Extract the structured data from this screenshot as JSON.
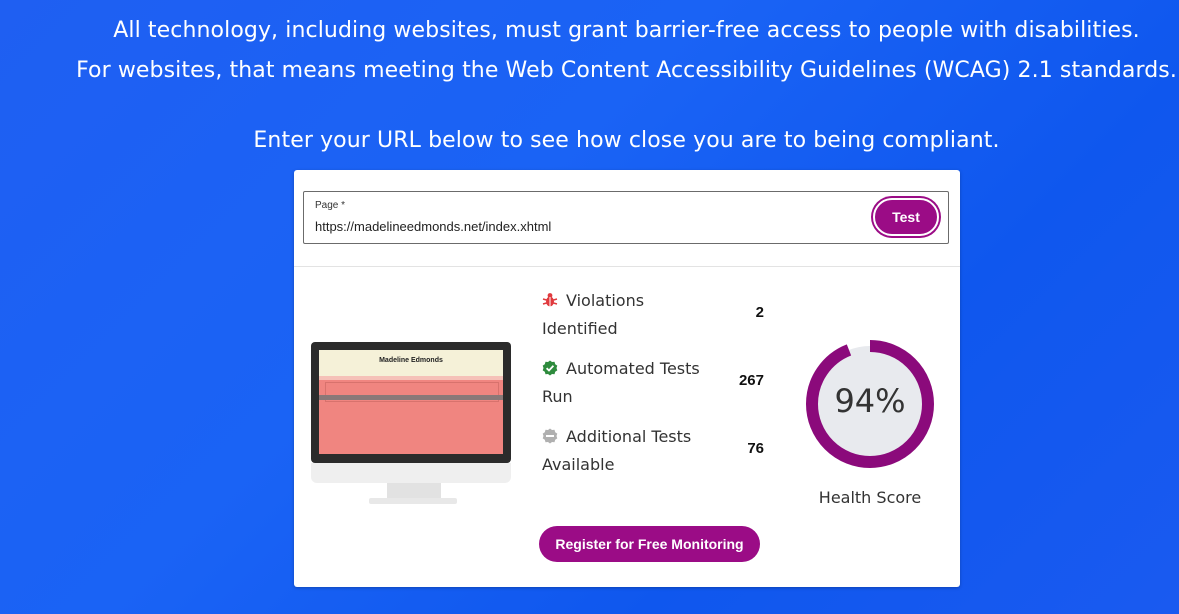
{
  "hero": {
    "line1": "All technology, including websites, must grant barrier-free access to people with disabilities.",
    "line2": "For websites, that means meeting the Web Content Accessibility Guidelines (WCAG) 2.1 standards.",
    "line3": "Enter your URL below to see how close you are to being compliant."
  },
  "form": {
    "label": "Page *",
    "url_value": "https://madelineedmonds.net/index.xhtml",
    "test_button": "Test"
  },
  "preview": {
    "site_title": "Madeline Edmonds"
  },
  "stats": [
    {
      "label": "Violations Identified",
      "value": "2",
      "icon": "bug-icon",
      "color": "#e03a3e"
    },
    {
      "label": "Automated Tests Run",
      "value": "267",
      "icon": "check-badge-icon",
      "color": "#2e8b3d"
    },
    {
      "label": "Additional Tests Available",
      "value": "76",
      "icon": "minus-badge-icon",
      "color": "#b0b0b0"
    }
  ],
  "health": {
    "score": 94,
    "score_text": "94%",
    "label": "Health Score",
    "ring_color": "#8b0a7b",
    "track_color": "#e8eaee"
  },
  "cta": {
    "register_button": "Register for Free Monitoring"
  },
  "colors": {
    "brand_purple": "#9b0c86",
    "background_blue": "#1a5ff2"
  }
}
